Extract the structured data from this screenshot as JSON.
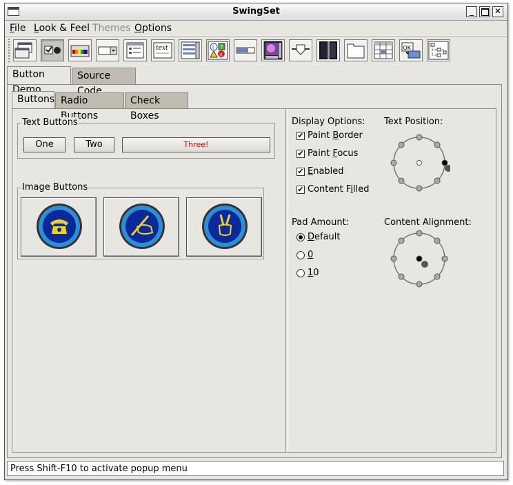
{
  "window": {
    "title": "SwingSet"
  },
  "menubar": {
    "items": [
      {
        "label": "File",
        "underline": "F",
        "rest": "ile",
        "enabled": true
      },
      {
        "label": "Look & Feel",
        "underline": "L",
        "rest": "ook & Feel",
        "enabled": true
      },
      {
        "label": "Themes",
        "enabled": false
      },
      {
        "label": "Options",
        "underline": "O",
        "rest": "ptions",
        "enabled": true
      }
    ]
  },
  "toolbar": {
    "icons": [
      "internal-frame-icon",
      "buttons-icon",
      "color-chooser-icon",
      "combobox-icon",
      "file-chooser-icon",
      "editor-pane-icon",
      "list-icon",
      "option-pane-icon",
      "progress-bar-icon",
      "scroll-pane-icon",
      "slider-icon",
      "split-pane-icon",
      "tabbed-pane-icon",
      "table-icon",
      "tooltip-icon",
      "tree-icon"
    ],
    "selected_index": 1
  },
  "demo_tabs": [
    {
      "label": "Button Demo",
      "selected": true
    },
    {
      "label": "Source Code",
      "selected": false
    }
  ],
  "button_tabs": [
    {
      "label": "Buttons",
      "selected": true
    },
    {
      "label": "Radio Buttons",
      "selected": false
    },
    {
      "label": "Check Boxes",
      "selected": false
    }
  ],
  "text_buttons": {
    "title": "Text Buttons",
    "one": "One",
    "two": "Two",
    "three": "Three!",
    "three_color": "#cc0000"
  },
  "image_buttons": {
    "title": "Image Buttons",
    "items": [
      "telephone-icon",
      "writing-hand-icon",
      "peace-sign-icon"
    ]
  },
  "display_options": {
    "title": "Display Options:",
    "paint_border": {
      "pre": "Paint ",
      "u": "B",
      "post": "order",
      "checked": true
    },
    "paint_focus": {
      "pre": "Paint ",
      "u": "F",
      "post": "ocus",
      "checked": true
    },
    "enabled": {
      "pre": "",
      "u": "E",
      "post": "nabled",
      "checked": true
    },
    "content_filled": {
      "pre": "Content F",
      "u": "i",
      "post": "lled",
      "checked": true
    }
  },
  "pad_amount": {
    "title": "Pad Amount:",
    "default": {
      "u": "D",
      "post": "efault",
      "selected": true
    },
    "zero": {
      "u": "0",
      "post": "",
      "selected": false
    },
    "ten": {
      "u": "1",
      "post": "0",
      "selected": false
    }
  },
  "text_position": {
    "title": "Text Position:",
    "selected": "right"
  },
  "content_alignment": {
    "title": "Content Alignment:",
    "selected": "center"
  },
  "status": {
    "text": "Press Shift-F10 to activate popup menu"
  },
  "colors": {
    "accent_blue": "#1a3fa0",
    "icon_yellow": "#f0d020",
    "frame_bg": "#e8e6e1"
  }
}
